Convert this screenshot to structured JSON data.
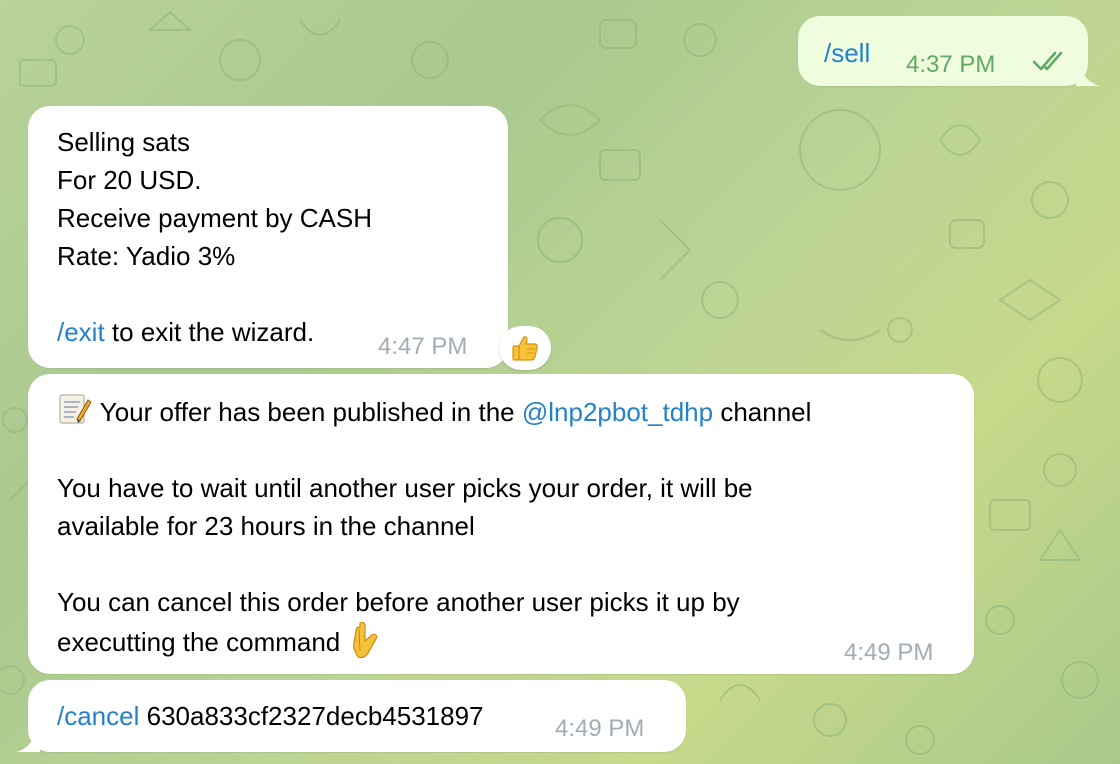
{
  "messages": {
    "sell": {
      "command": "/sell",
      "time": "4:37 PM"
    },
    "wizard": {
      "lines": [
        "Selling sats",
        "For 20 USD.",
        "Receive payment by CASH",
        "Rate: Yadio 3%"
      ],
      "exit_command": "/exit",
      "exit_text": " to exit the wizard.",
      "time": "4:47 PM",
      "reaction": "thumbs-up"
    },
    "published": {
      "text_before": " Your offer has been published in the ",
      "mention": "@lnp2pbot_tdhp",
      "text_after": " channel",
      "wait_line1": "You have to wait until another user picks your order, it will be",
      "wait_line2": "available for 23 hours in the channel",
      "cancel_line1": "You can cancel this order before another user picks it up by",
      "cancel_line2": "executting the command ",
      "time": "4:49 PM"
    },
    "cancel": {
      "command": "/cancel",
      "order_id": " 630a833cf2327decb4531897",
      "time": "4:49 PM"
    }
  },
  "icons": {
    "memo": "memo-icon",
    "pointing_down": "pointing-down-icon",
    "double_check": "double-check-icon",
    "thumbs_up": "thumbs-up-icon"
  },
  "colors": {
    "link": "#2481cc",
    "outgoing_bubble": "#effdde",
    "outgoing_time": "#5fa963",
    "incoming_time": "#a0acb6"
  }
}
